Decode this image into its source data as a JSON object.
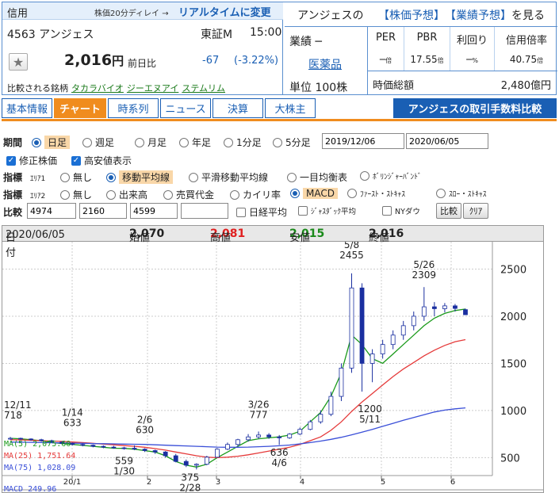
{
  "header": {
    "shinyo": "信用",
    "delay_note": "株価20分ディレイ →",
    "realtime_link": "リアルタイムに変更",
    "code_name": "4563 アンジェス",
    "market": "東証M",
    "time": "15:00",
    "price": "2,016",
    "yen": "円",
    "change_label": "前日比",
    "change": "-67",
    "change_pct": "(-3.22%)",
    "compare_label": "比較される銘柄",
    "compare_links": [
      "タカラバイオ",
      "ジーエヌアイ",
      "ステムリム"
    ],
    "yoso_prefix": "アンジェスの",
    "yoso_link1": "【株価予想】",
    "yoso_link2": "【業績予想】",
    "yoso_tail": "を見る",
    "gyoshu_label": "業績 ─",
    "gyoshu_value": "医薬品",
    "tani": "単位 100株",
    "ratios": [
      {
        "label": "PER",
        "value": "─",
        "unit": "倍"
      },
      {
        "label": "PBR",
        "value": "17.55",
        "unit": "倍"
      },
      {
        "label": "利回り",
        "value": "─",
        "unit": "%"
      },
      {
        "label": "信用倍率",
        "value": "40.75",
        "unit": "倍"
      }
    ],
    "mcap_label": "時価総額",
    "mcap_value": "2,480億円"
  },
  "tabs": [
    {
      "label": "基本情報",
      "active": false
    },
    {
      "label": "チャート",
      "active": true
    },
    {
      "label": "時系列",
      "active": false
    },
    {
      "label": "ニュース",
      "active": false
    },
    {
      "label": "決算",
      "active": false
    },
    {
      "label": "大株主",
      "active": false
    }
  ],
  "fee_button": "アンジェスの取引手数料比較",
  "controls": {
    "period_label": "期間",
    "periods": [
      "日足",
      "週足",
      "月足",
      "年足",
      "1分足",
      "5分足"
    ],
    "period_selected": "日足",
    "date_from": "2019/12/06",
    "date_to": "2020/06/05",
    "adjusted": "修正株価",
    "highlow": "高安値表示",
    "indicator_label": "指標",
    "area1": "ｴﾘｱ1",
    "area1_opts": [
      "無し",
      "移動平均線",
      "平滑移動平均線",
      "一目均衡表",
      "ﾎﾞﾘﾝｼﾞｬｰﾊﾞﾝﾄﾞ"
    ],
    "area1_selected": "移動平均線",
    "area2": "ｴﾘｱ2",
    "area2_opts": [
      "無し",
      "出来高",
      "売買代金",
      "カイリ率",
      "MACD",
      "ﾌｧｰｽﾄ・ｽﾄｷｬｽ",
      "ｽﾛｰ・ｽﾄｷｬｽ"
    ],
    "area2_selected": "MACD",
    "compare_label": "比較",
    "compare_codes": [
      "4974",
      "2160",
      "4599",
      ""
    ],
    "index_checks": [
      "日経平均",
      "ｼﾞｬｽﾀﾞｯｸ平均",
      "NYダウ"
    ],
    "compare_btn": "比較",
    "clear_btn": "ｸﾘｱ"
  },
  "ohlc": {
    "date_label": "日付",
    "date": "2020/06/05",
    "open_label": "始値",
    "open": "2,070",
    "high_label": "高値",
    "high": "2,081",
    "low_label": "安値",
    "low": "2,015",
    "close_label": "終値",
    "close": "2,016"
  },
  "ma_legend": [
    {
      "label": "MA(5)",
      "value": "2,075.60",
      "color": "#1a9a1a"
    },
    {
      "label": "MA(25)",
      "value": "1,751.64",
      "color": "#e53a3a"
    },
    {
      "label": "MA(75)",
      "value": "1,028.09",
      "color": "#3a4fd8"
    }
  ],
  "macd_label": "MACD",
  "macd_value": "249.96",
  "colors": {
    "accent": "#1a5fb4",
    "tab_active": "#f08c1e",
    "up": "#ffffff",
    "down": "#1a2fa0"
  },
  "chart_data": {
    "type": "line",
    "y_ticks": [
      500,
      1000,
      1500,
      2000,
      2500
    ],
    "ylim": [
      310,
      2790
    ],
    "x_ticks": [
      "20/1",
      "2",
      "3",
      "4",
      "5",
      "6"
    ],
    "annotations": [
      {
        "date": "12/11",
        "value": "718"
      },
      {
        "date": "1/14",
        "value": "633"
      },
      {
        "date": "1/30",
        "value": "559"
      },
      {
        "date": "2/6",
        "value": "630"
      },
      {
        "date": "2/28",
        "value": "375"
      },
      {
        "date": "3/26",
        "value": "777"
      },
      {
        "date": "4/6",
        "value": "636"
      },
      {
        "date": "5/8",
        "value": "2455"
      },
      {
        "date": "5/11",
        "value": "1200"
      },
      {
        "date": "5/26",
        "value": "2309"
      }
    ],
    "series": [
      {
        "name": "MA(5)",
        "values": [
          705,
          700,
          690,
          680,
          660,
          650,
          640,
          630,
          620,
          610,
          600,
          598,
          590,
          575,
          560,
          520,
          460,
          420,
          400,
          430,
          500,
          560,
          620,
          680,
          700,
          710,
          720,
          740,
          780,
          880,
          980,
          1150,
          1400,
          1800,
          1700,
          1550,
          1500,
          1600,
          1700,
          1800,
          1900,
          1980,
          2030,
          2060,
          2076
        ]
      },
      {
        "name": "MA(25)",
        "values": [
          690,
          688,
          684,
          680,
          676,
          672,
          666,
          660,
          652,
          644,
          636,
          628,
          620,
          610,
          596,
          580,
          560,
          540,
          520,
          505,
          500,
          505,
          515,
          530,
          550,
          570,
          590,
          610,
          640,
          680,
          720,
          790,
          880,
          990,
          1090,
          1180,
          1270,
          1360,
          1440,
          1510,
          1580,
          1640,
          1690,
          1730,
          1752
        ]
      },
      {
        "name": "MA(75)",
        "values": [
          665,
          664,
          662,
          660,
          658,
          656,
          654,
          652,
          650,
          648,
          646,
          644,
          642,
          640,
          636,
          632,
          628,
          624,
          620,
          616,
          612,
          610,
          610,
          612,
          616,
          620,
          626,
          634,
          646,
          660,
          676,
          694,
          716,
          742,
          770,
          800,
          832,
          864,
          896,
          926,
          956,
          984,
          1004,
          1018,
          1028
        ]
      }
    ],
    "candles": [
      [
        700,
        720,
        690,
        705
      ],
      [
        705,
        712,
        690,
        698
      ],
      [
        698,
        705,
        680,
        690
      ],
      [
        690,
        700,
        670,
        680
      ],
      [
        680,
        690,
        660,
        665
      ],
      [
        665,
        675,
        645,
        650
      ],
      [
        650,
        660,
        630,
        640
      ],
      [
        640,
        650,
        620,
        632
      ],
      [
        632,
        640,
        610,
        620
      ],
      [
        620,
        630,
        600,
        612
      ],
      [
        612,
        625,
        595,
        604
      ],
      [
        604,
        615,
        585,
        600
      ],
      [
        600,
        630,
        580,
        590
      ],
      [
        590,
        600,
        560,
        575
      ],
      [
        575,
        585,
        540,
        560
      ],
      [
        560,
        570,
        500,
        520
      ],
      [
        520,
        540,
        450,
        460
      ],
      [
        460,
        480,
        400,
        420
      ],
      [
        420,
        440,
        375,
        430
      ],
      [
        430,
        520,
        420,
        505
      ],
      [
        505,
        600,
        500,
        590
      ],
      [
        590,
        660,
        580,
        640
      ],
      [
        640,
        700,
        620,
        690
      ],
      [
        690,
        750,
        670,
        720
      ],
      [
        720,
        777,
        700,
        740
      ],
      [
        740,
        760,
        700,
        720
      ],
      [
        720,
        740,
        636,
        710
      ],
      [
        710,
        760,
        700,
        750
      ],
      [
        750,
        820,
        740,
        800
      ],
      [
        800,
        900,
        790,
        880
      ],
      [
        880,
        1000,
        860,
        960
      ],
      [
        960,
        1200,
        940,
        1150
      ],
      [
        1150,
        1500,
        1100,
        1450
      ],
      [
        1450,
        2455,
        1400,
        2300
      ],
      [
        2300,
        2350,
        1200,
        1500
      ],
      [
        1500,
        1650,
        1300,
        1600
      ],
      [
        1600,
        1750,
        1550,
        1700
      ],
      [
        1700,
        1850,
        1650,
        1800
      ],
      [
        1800,
        1950,
        1750,
        1900
      ],
      [
        1900,
        2050,
        1850,
        2000
      ],
      [
        2000,
        2309,
        1950,
        2100
      ],
      [
        2100,
        2150,
        2000,
        2080
      ],
      [
        2080,
        2140,
        2040,
        2110
      ],
      [
        2110,
        2130,
        2050,
        2083
      ],
      [
        2070,
        2081,
        2015,
        2016
      ]
    ]
  }
}
